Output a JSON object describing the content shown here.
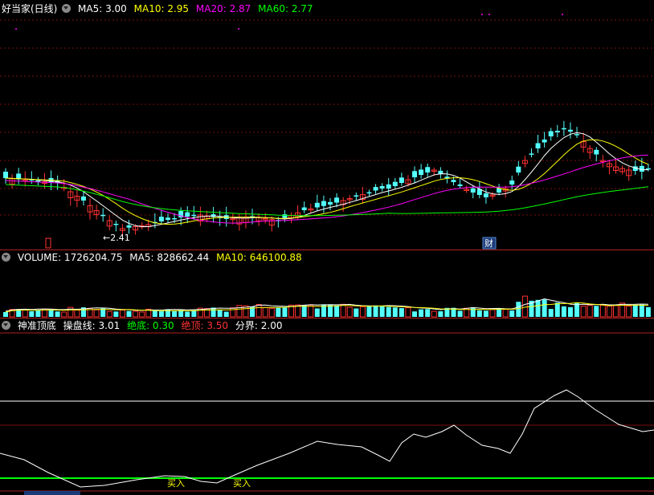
{
  "price_panel": {
    "title": "好当家(日线)",
    "indicators": [
      {
        "label": "MA5: 3.00",
        "color": "#ffffff"
      },
      {
        "label": "MA10: 2.95",
        "color": "#ffff00"
      },
      {
        "label": "MA20: 2.87",
        "color": "#ff00ff"
      },
      {
        "label": "MA60: 2.77",
        "color": "#00ff00"
      }
    ],
    "low_marker": "2.41",
    "event_tag": "财",
    "up_color": "#ff3232",
    "down_color": "#54ffff"
  },
  "volume_panel": {
    "indicators": [
      {
        "label": "VOLUME: 1726204.75",
        "color": "#ffffff"
      },
      {
        "label": "MA5: 828662.44",
        "color": "#ffffff"
      },
      {
        "label": "MA10: 646100.88",
        "color": "#ffff00"
      }
    ]
  },
  "indicator_panel": {
    "name": "神准顶底",
    "indicators": [
      {
        "label": "操盘线: 3.01",
        "color": "#ffffff"
      },
      {
        "label": "绝底: 0.30",
        "color": "#00ff00"
      },
      {
        "label": "绝顶: 3.50",
        "color": "#ff3232"
      },
      {
        "label": "分界: 2.00",
        "color": "#ffffff"
      }
    ],
    "buy_signal_1": "买入",
    "buy_signal_2": "买入"
  },
  "chart_data": {
    "type": "candlestick",
    "ma_values": {
      "MA5": 3.0,
      "MA10": 2.95,
      "MA20": 2.87,
      "MA60": 2.77
    },
    "period_low": 2.41,
    "volume": 1726204.75,
    "volume_ma5": 828662.44,
    "volume_ma10": 646100.88,
    "oscillator": {
      "operating_line": 3.01,
      "absolute_bottom": 0.3,
      "absolute_top": 3.5,
      "divider": 2.0
    }
  }
}
